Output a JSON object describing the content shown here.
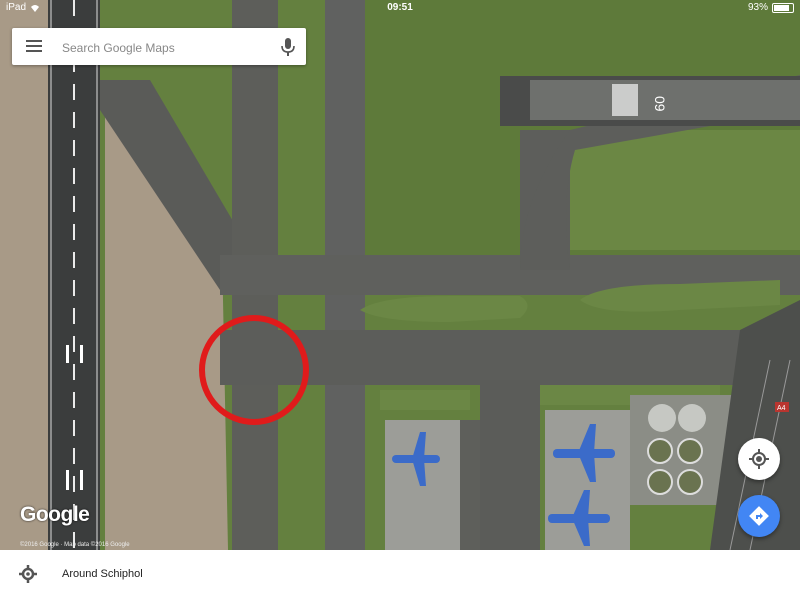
{
  "status_bar": {
    "device": "iPad",
    "time": "09:51",
    "battery": "93%",
    "battery_level": 0.93,
    "icons": [
      "wifi-icon",
      "battery-icon"
    ]
  },
  "search": {
    "placeholder": "Search Google Maps",
    "value": "",
    "icons": [
      "menu-icon",
      "microphone-icon"
    ]
  },
  "map": {
    "logo": "Google",
    "copyright": "©2016 Google · Map data ©2016 Google",
    "runway_marking": "09",
    "road_sign": "A4",
    "annotation": "red-circle-marker"
  },
  "fab": {
    "locate_icon": "my-location-icon",
    "directions_icon": "directions-icon"
  },
  "bottom_bar": {
    "label": "Around Schiphol",
    "icon": "settings-gear-icon"
  },
  "colors": {
    "accent": "#4286f4",
    "marker": "#e01b1b"
  }
}
